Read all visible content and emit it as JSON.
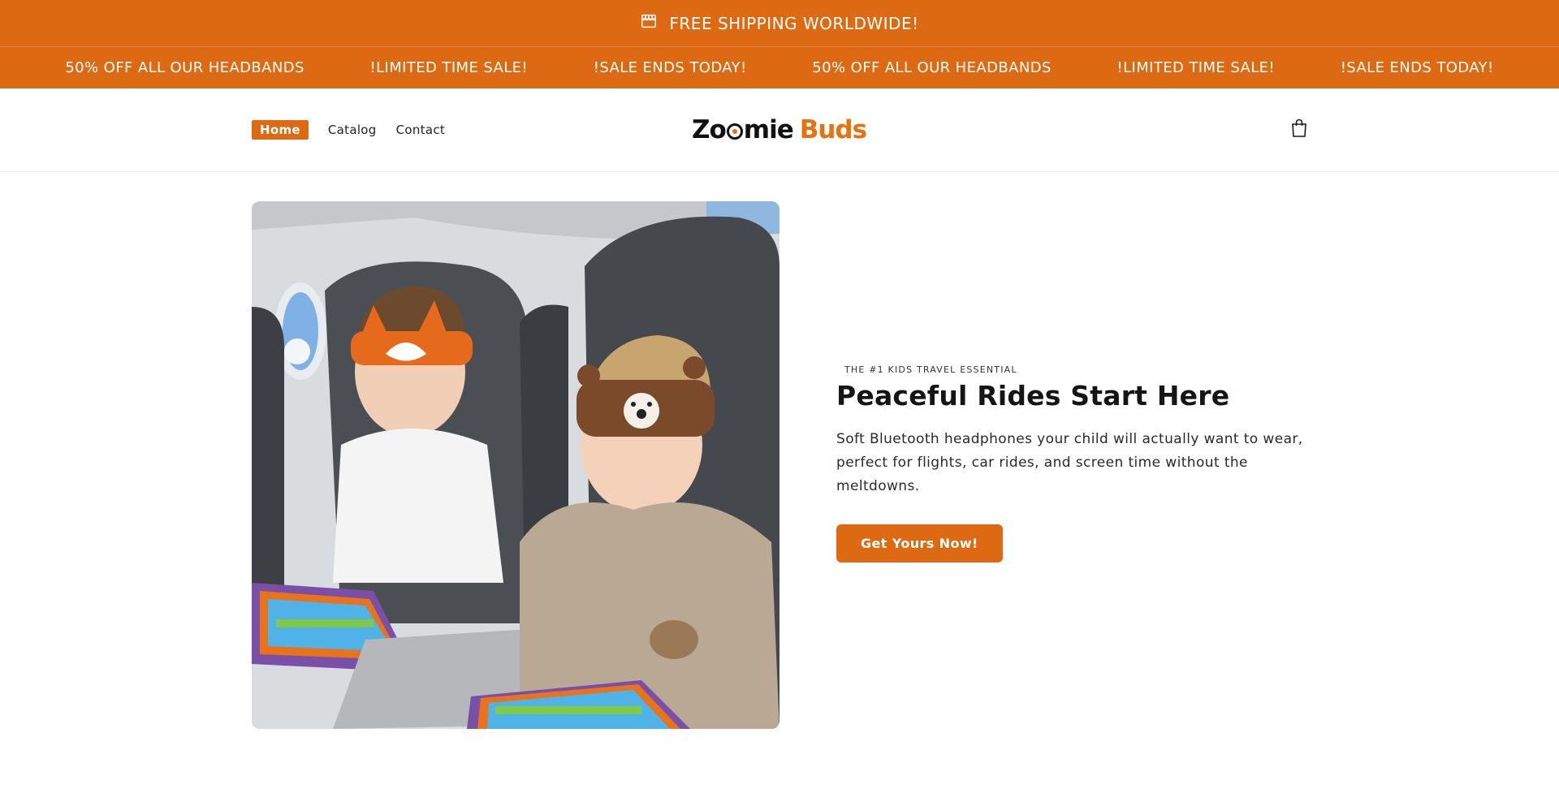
{
  "announcement": {
    "text": "FREE SHIPPING WORLDWIDE!",
    "icon": "store-icon"
  },
  "marquee": {
    "items": [
      "50% OFF ALL OUR HEADBANDS",
      "!LIMITED TIME SALE!",
      "!SALE ENDS TODAY!",
      "50% OFF ALL OUR HEADBANDS",
      "!LIMITED TIME SALE!",
      "!SALE ENDS TODAY!"
    ]
  },
  "header": {
    "nav": [
      {
        "label": "Home",
        "active": true
      },
      {
        "label": "Catalog",
        "active": false
      },
      {
        "label": "Contact",
        "active": false
      }
    ],
    "logo": {
      "part1_a": "Zo",
      "part1_b": "mie",
      "part2": "Buds"
    },
    "cart_icon": "shopping-bag-icon"
  },
  "hero": {
    "image_alt": "Two children wearing animal headband headphones using tablets on an airplane",
    "eyebrow": "THE #1 KIDS TRAVEL ESSENTIAL",
    "headline": "Peaceful Rides Start Here",
    "body": "Soft Bluetooth headphones your child will actually want to wear, perfect for flights, car rides, and screen time without the meltdowns.",
    "cta": "Get Yours Now!"
  },
  "colors": {
    "brand_orange": "#dd6a12",
    "logo_orange": "#e8710f"
  }
}
